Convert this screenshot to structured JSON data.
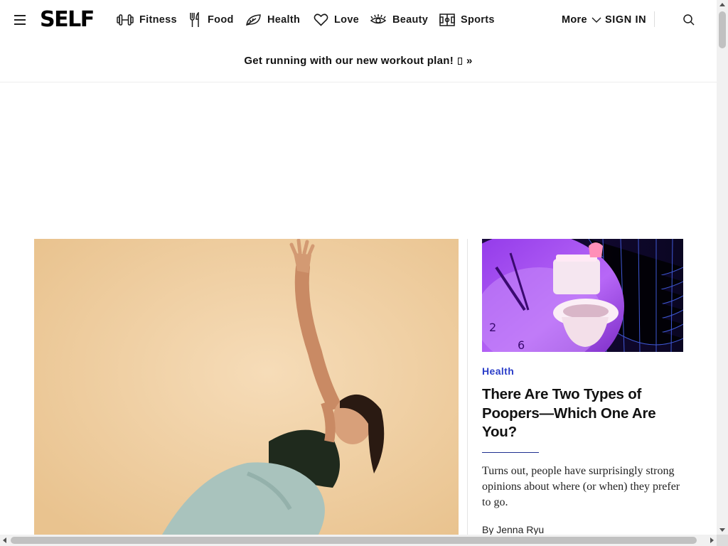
{
  "header": {
    "logo": "SELF",
    "nav_items": [
      {
        "label": "Fitness",
        "icon": "dumbbell-icon"
      },
      {
        "label": "Food",
        "icon": "fork-icon"
      },
      {
        "label": "Health",
        "icon": "leaf-icon"
      },
      {
        "label": "Love",
        "icon": "heart-icon"
      },
      {
        "label": "Beauty",
        "icon": "eye-lashes-icon"
      },
      {
        "label": "Sports",
        "icon": "field-icon"
      }
    ],
    "more_label": "More",
    "signin_label": "SIGN IN"
  },
  "promo": {
    "text": "Get running with our new workout plan!",
    "suffix": "»"
  },
  "feature": {
    "category": "Health",
    "headline": "There Are Two Types of Poopers—Which One Are You?",
    "dek": "Turns out, people have surprisingly strong opinions about where (or when) they prefer to go.",
    "byline_prefix": "By",
    "author": "Jenna Ryu"
  },
  "colors": {
    "accent": "#2b3ec9",
    "hero_background": "#eecb9c",
    "thumb_purple": "#a64cf2"
  }
}
